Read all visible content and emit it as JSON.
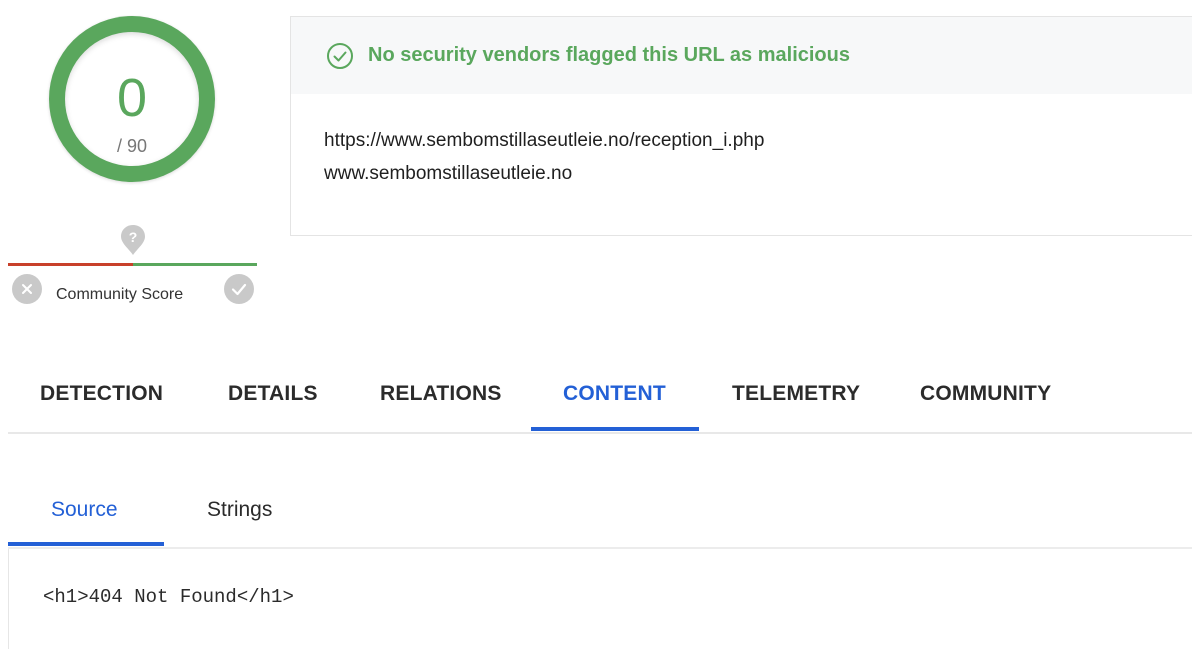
{
  "score": {
    "value": "0",
    "total": "/ 90",
    "color": "#5aa75d"
  },
  "community": {
    "label": "Community Score",
    "icons": {
      "question": "question-marker-icon",
      "negative": "close-circle-icon",
      "positive": "check-circle-icon"
    }
  },
  "result": {
    "banner_text": "No security vendors flagged this URL as malicious",
    "banner_icon": "check-circle-outline-icon",
    "url": "https://www.sembomstillaseutleie.no/reception_i.php",
    "domain": "www.sembomstillaseutleie.no"
  },
  "main_tabs": [
    {
      "label": "DETECTION",
      "active": false
    },
    {
      "label": "DETAILS",
      "active": false
    },
    {
      "label": "RELATIONS",
      "active": false
    },
    {
      "label": "CONTENT",
      "active": true
    },
    {
      "label": "TELEMETRY",
      "active": false
    },
    {
      "label": "COMMUNITY",
      "active": false
    }
  ],
  "sub_tabs": [
    {
      "label": "Source",
      "active": true
    },
    {
      "label": "Strings",
      "active": false
    }
  ],
  "source": {
    "code": "<h1>404 Not Found</h1>"
  },
  "colors": {
    "accent": "#2360d6",
    "safe": "#5aa75d",
    "danger": "#c8402a"
  }
}
